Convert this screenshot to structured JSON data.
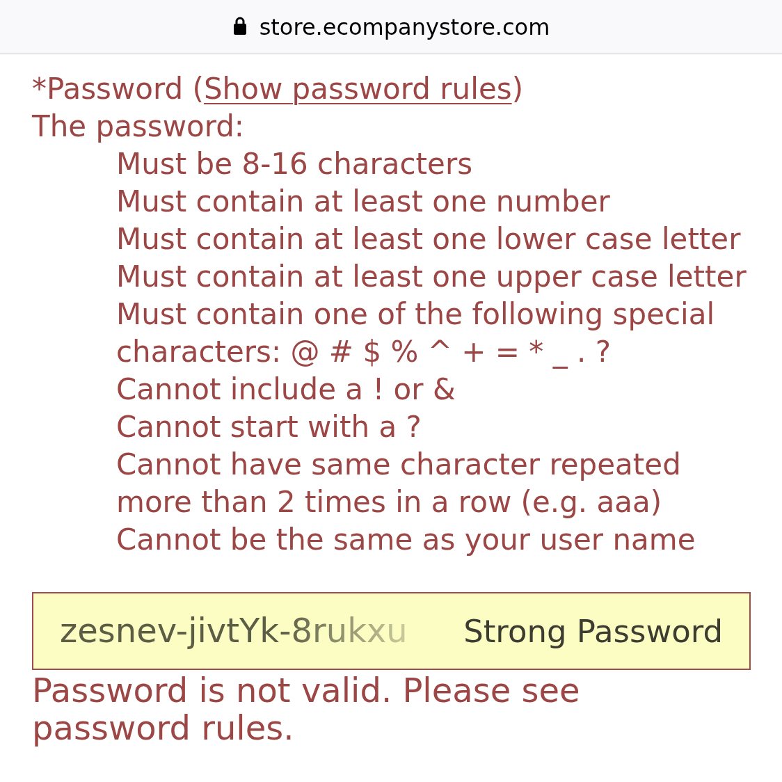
{
  "address_bar": {
    "url": "store.ecompanystore.com"
  },
  "password_label": {
    "prefix": "*Password (",
    "link": "Show password rules",
    "suffix": ")"
  },
  "rules_intro": "The password:",
  "rules": [
    "Must be 8-16 characters",
    "Must contain at least one number",
    "Must contain at least one lower case letter",
    "Must contain at least one upper case letter",
    "Must contain one of the following special characters: @ # $ % ^ + = * _ . ?",
    "Cannot include a ! or &",
    "Cannot start with a ?",
    "Cannot have same character repeated more than 2 times in a row (e.g. aaa)",
    "Cannot be the same as your user name"
  ],
  "password_field": {
    "value": "zesnev-jivtYk-8rukxu",
    "suggestion": "Strong Password"
  },
  "error": "Password is not valid. Please see password rules."
}
